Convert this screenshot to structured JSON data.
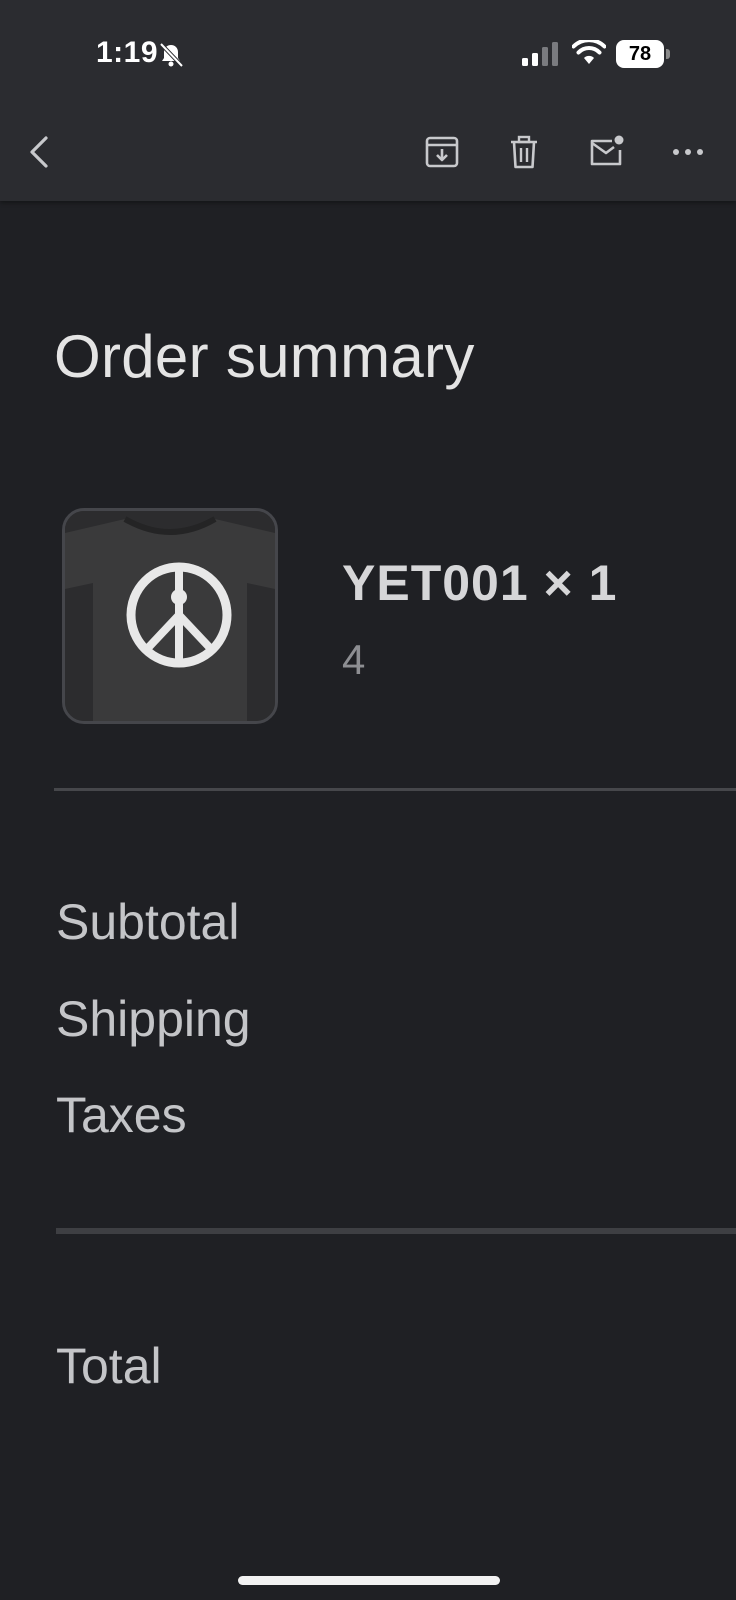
{
  "status_bar": {
    "time": "1:19",
    "battery": "78"
  },
  "toolbar": {
    "back_icon": "chevron-left-icon",
    "archive_icon": "archive-icon",
    "delete_icon": "trash-icon",
    "unread_icon": "mail-unread-icon",
    "more_icon": "more-horizontal-icon"
  },
  "order": {
    "title": "Order summary",
    "item": {
      "name": "YET001 × 1",
      "variant": "4",
      "image_icon": "tshirt-image"
    },
    "summary": {
      "subtotal_label": "Subtotal",
      "shipping_label": "Shipping",
      "taxes_label": "Taxes",
      "total_label": "Total"
    }
  },
  "colors": {
    "background": "#1f2024",
    "toolbar": "#2b2c30",
    "text_primary": "#e4e4e4",
    "text_secondary": "#8d8e92"
  }
}
